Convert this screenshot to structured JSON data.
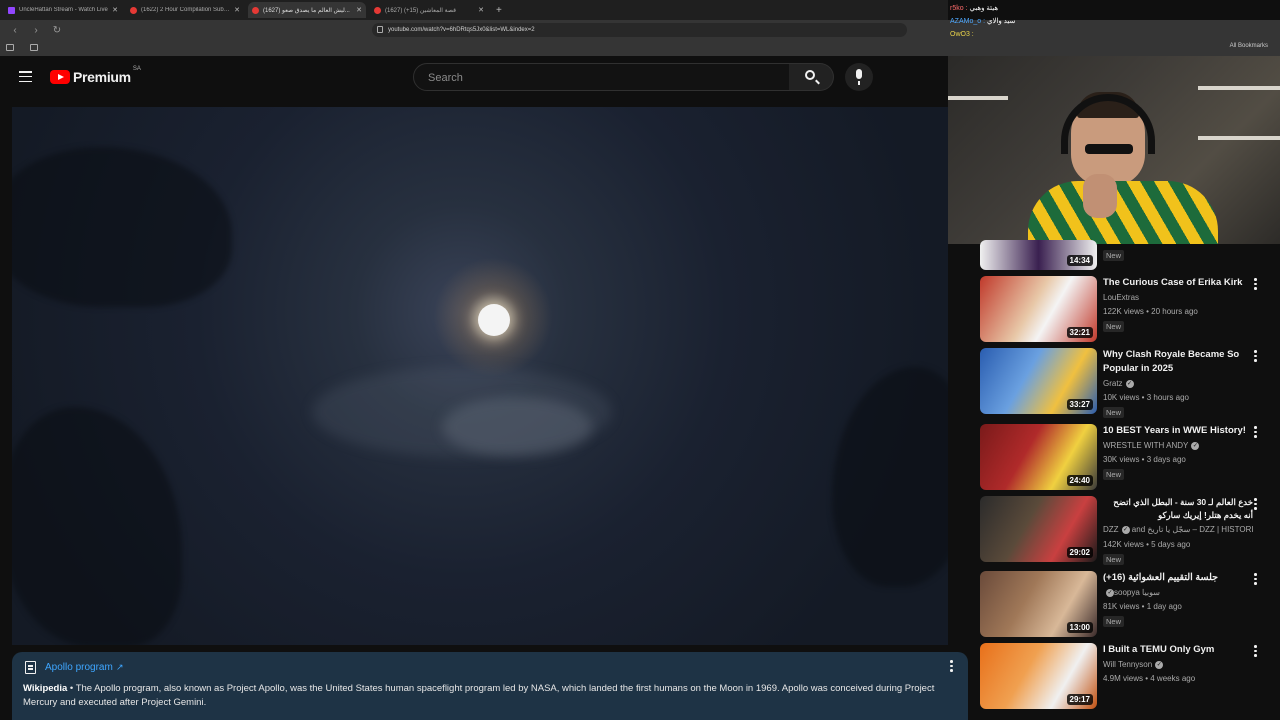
{
  "browser": {
    "tabs": [
      {
        "title": "UncleHattan Stream - Watch Live",
        "icon": "twitch-icon",
        "active": false
      },
      {
        "title": "(1622) 2 Hour Compilation Subway",
        "icon": "youtube-icon",
        "active": false
      },
      {
        "title": "(1627) ليش العالم ما يصدق صعو...",
        "icon": "youtube-icon",
        "active": true
      },
      {
        "title": "(1627) قصة المعاشين (15+)",
        "icon": "youtube-icon",
        "active": false
      }
    ],
    "url": "youtube.com/watch?v=6hDRtqs5Jx0&list=WL&index=2",
    "bookmarks_label": "All Bookmarks"
  },
  "chat": [
    {
      "user": "r5ko :",
      "message": "هيئة وهبي",
      "user_color": "#ff6b6b"
    },
    {
      "user": "AZAMo_o :",
      "message": "سيد والاي",
      "user_color": "#4fa9ff"
    },
    {
      "user": "OwO3 :",
      "message": "",
      "user_color": "#e8d24a"
    }
  ],
  "youtube": {
    "logo_text": "Premium",
    "country_code": "SA",
    "search_placeholder": "Search"
  },
  "info_card": {
    "title": "Apollo program",
    "source": "Wikipedia",
    "text": " • The Apollo program, also known as Project Apollo, was the United States human spaceflight program led by NASA, which landed the first humans on the Moon in 1969. Apollo was conceived during Project Mercury and executed after Project Gemini."
  },
  "recommendations": [
    {
      "title": "",
      "channel": "",
      "meta": "",
      "duration": "14:34",
      "badge": "New",
      "thumb_colors": [
        "#3a2050",
        "#c8c8c8"
      ]
    },
    {
      "title": "The Curious Case of Erika Kirk",
      "channel": "LouExtras",
      "verified": false,
      "meta": "122K views • 20 hours ago",
      "duration": "32:21",
      "badge": "New",
      "thumb_colors": [
        "#c0392b",
        "#e8c8a8"
      ]
    },
    {
      "title": "Why Clash Royale Became So Popular in 2025",
      "channel": "Gratz",
      "verified": true,
      "meta": "10K views • 3 hours ago",
      "duration": "33:27",
      "badge": "New",
      "thumb_colors": [
        "#2a5db0",
        "#f0c040"
      ]
    },
    {
      "title": "10 BEST Years in WWE History!",
      "channel": "WRESTLE WITH ANDY",
      "verified": true,
      "meta": "30K views • 3 days ago",
      "duration": "24:40",
      "badge": "New",
      "thumb_colors": [
        "#b02a2a",
        "#f0d040"
      ]
    },
    {
      "title": "خدع العالم لـ 30 سنة - البطل الذي اتضح أنه يخدم هتلر! إيريك ساركو",
      "channel": "DZZ",
      "verified": true,
      "channel_extra": "and سجّل يا تاريخ – DZZ | HISTORIA...",
      "meta": "142K views • 5 days ago",
      "duration": "29:02",
      "badge": "New",
      "thumb_colors": [
        "#2b2b2b",
        "#c94040"
      ]
    },
    {
      "title": "جلسة التقييم العشوائية (16+)",
      "channel": "soopya",
      "verified": true,
      "channel_extra": "سوبيا",
      "meta": "81K views • 1 day ago",
      "duration": "13:00",
      "badge": "New",
      "thumb_colors": [
        "#6a4a3a",
        "#d8b898"
      ]
    },
    {
      "title": "I Built a TEMU Only Gym",
      "channel": "Will Tennyson",
      "verified": true,
      "meta": "4.9M views • 4 weeks ago",
      "duration": "29:17",
      "badge": "",
      "thumb_colors": [
        "#e8701a",
        "#f0f0f0"
      ]
    }
  ],
  "colors": {
    "accent_red": "#ff0000",
    "link_blue": "#3ea6ff",
    "info_card_bg": "#1e3345"
  }
}
